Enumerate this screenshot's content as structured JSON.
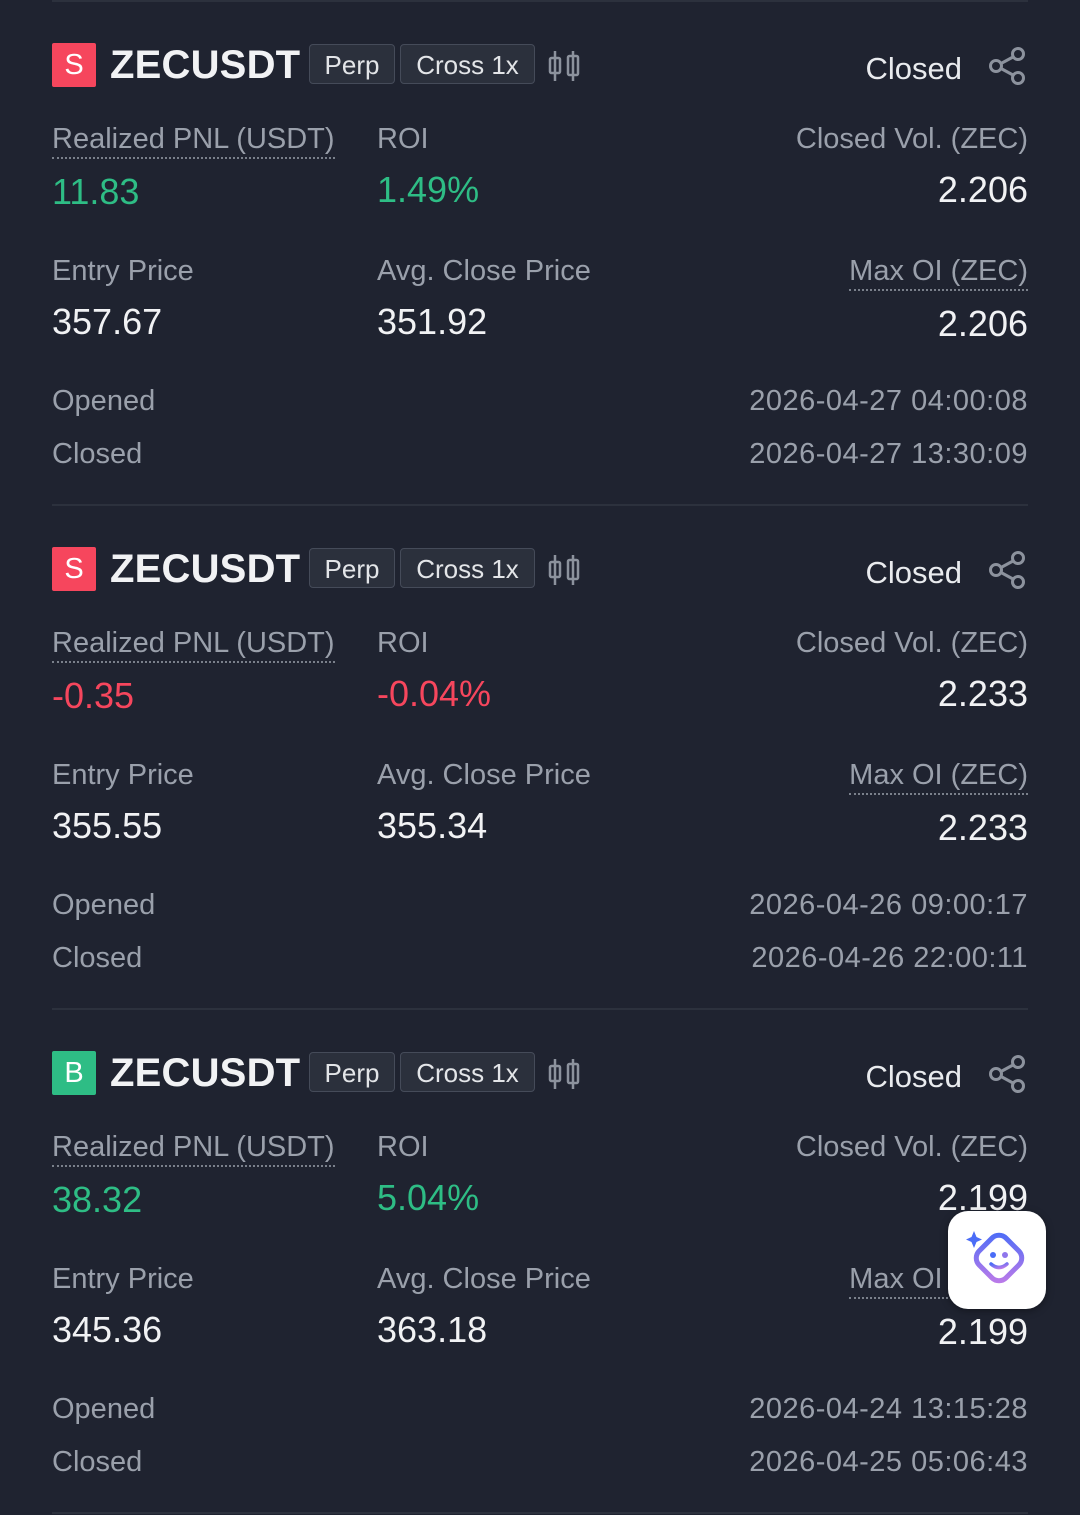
{
  "positions": [
    {
      "side": "S",
      "side_type": "short",
      "symbol": "ZECUSDT",
      "type_tag": "Perp",
      "margin_tag": "Cross 1x",
      "status": "Closed",
      "pnl_label": "Realized PNL (USDT)",
      "pnl": "11.83",
      "pnl_sign": "pos",
      "roi_label": "ROI",
      "roi": "1.49%",
      "closed_vol_label": "Closed Vol. (ZEC)",
      "closed_vol": "2.206",
      "entry_label": "Entry Price",
      "entry_price": "357.67",
      "avg_close_label": "Avg. Close Price",
      "avg_close_price": "351.92",
      "max_oi_label": "Max OI (ZEC)",
      "max_oi": "2.206",
      "opened_label": "Opened",
      "opened": "2026-04-27 04:00:08",
      "closed_label": "Closed",
      "closed": "2026-04-27 13:30:09"
    },
    {
      "side": "S",
      "side_type": "short",
      "symbol": "ZECUSDT",
      "type_tag": "Perp",
      "margin_tag": "Cross 1x",
      "status": "Closed",
      "pnl_label": "Realized PNL (USDT)",
      "pnl": "-0.35",
      "pnl_sign": "neg",
      "roi_label": "ROI",
      "roi": "-0.04%",
      "closed_vol_label": "Closed Vol. (ZEC)",
      "closed_vol": "2.233",
      "entry_label": "Entry Price",
      "entry_price": "355.55",
      "avg_close_label": "Avg. Close Price",
      "avg_close_price": "355.34",
      "max_oi_label": "Max OI (ZEC)",
      "max_oi": "2.233",
      "opened_label": "Opened",
      "opened": "2026-04-26 09:00:17",
      "closed_label": "Closed",
      "closed": "2026-04-26 22:00:11"
    },
    {
      "side": "B",
      "side_type": "long",
      "symbol": "ZECUSDT",
      "type_tag": "Perp",
      "margin_tag": "Cross 1x",
      "status": "Closed",
      "pnl_label": "Realized PNL (USDT)",
      "pnl": "38.32",
      "pnl_sign": "pos",
      "roi_label": "ROI",
      "roi": "5.04%",
      "closed_vol_label": "Closed Vol. (ZEC)",
      "closed_vol": "2.199",
      "entry_label": "Entry Price",
      "entry_price": "345.36",
      "avg_close_label": "Avg. Close Price",
      "avg_close_price": "363.18",
      "max_oi_label": "Max OI (ZEC)",
      "max_oi": "2.199",
      "opened_label": "Opened",
      "opened": "2026-04-24 13:15:28",
      "closed_label": "Closed",
      "closed": "2026-04-25 05:06:43"
    }
  ],
  "icons": {
    "chart": "candlestick-chart-icon",
    "share": "share-icon",
    "assistant": "ai-assistant-icon"
  },
  "colors": {
    "background": "#1f2330",
    "positive": "#2ebd85",
    "negative": "#f6465d",
    "label": "#9aa0ab",
    "text": "#f1f2f4"
  }
}
